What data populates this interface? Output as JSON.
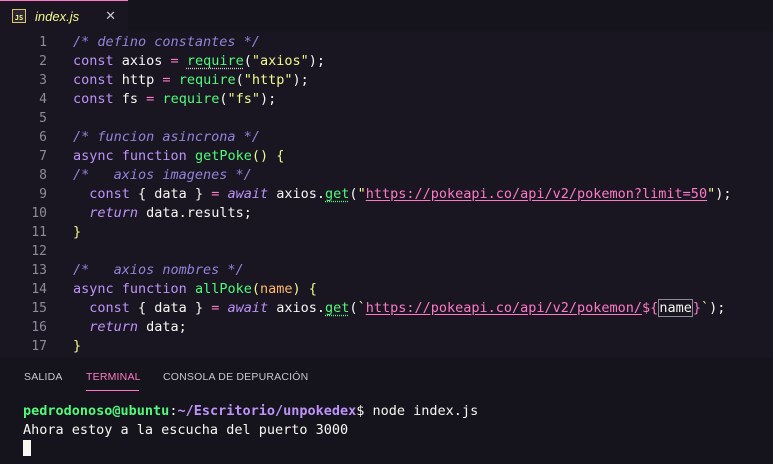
{
  "tab": {
    "icon": "JS",
    "filename": "index.js",
    "close": "✕"
  },
  "editor": {
    "lines": [
      {
        "n": "1",
        "tokens": [
          {
            "t": "/* defino constantes */",
            "c": "comment"
          }
        ]
      },
      {
        "n": "2",
        "tokens": [
          {
            "t": "const ",
            "c": "kw"
          },
          {
            "t": "axios",
            "c": "var"
          },
          {
            "t": " = ",
            "c": "op"
          },
          {
            "t": "require",
            "c": "req"
          },
          {
            "t": "(",
            "c": "var"
          },
          {
            "t": "\"axios\"",
            "c": "str"
          },
          {
            "t": ");",
            "c": "var"
          }
        ]
      },
      {
        "n": "3",
        "tokens": [
          {
            "t": "const ",
            "c": "kw"
          },
          {
            "t": "http",
            "c": "var"
          },
          {
            "t": " = ",
            "c": "op"
          },
          {
            "t": "require",
            "c": "fn"
          },
          {
            "t": "(",
            "c": "var"
          },
          {
            "t": "\"http\"",
            "c": "str"
          },
          {
            "t": ");",
            "c": "var"
          }
        ]
      },
      {
        "n": "4",
        "tokens": [
          {
            "t": "const ",
            "c": "kw"
          },
          {
            "t": "fs",
            "c": "var"
          },
          {
            "t": " = ",
            "c": "op"
          },
          {
            "t": "require",
            "c": "fn"
          },
          {
            "t": "(",
            "c": "var"
          },
          {
            "t": "\"fs\"",
            "c": "str"
          },
          {
            "t": ");",
            "c": "var"
          }
        ]
      },
      {
        "n": "5",
        "tokens": []
      },
      {
        "n": "6",
        "tokens": [
          {
            "t": "/* funcion asincrona */",
            "c": "comment"
          }
        ]
      },
      {
        "n": "7",
        "tokens": [
          {
            "t": "async ",
            "c": "kw"
          },
          {
            "t": "function ",
            "c": "kw"
          },
          {
            "t": "getPoke",
            "c": "fn"
          },
          {
            "t": "() {",
            "c": "brk"
          }
        ]
      },
      {
        "n": "8",
        "tokens": [
          {
            "t": "/*   axios imagenes */",
            "c": "comment"
          }
        ]
      },
      {
        "n": "9",
        "tokens": [
          {
            "t": "  const ",
            "c": "kw"
          },
          {
            "t": "{ ",
            "c": "var"
          },
          {
            "t": "data",
            "c": "var"
          },
          {
            "t": " } ",
            "c": "var"
          },
          {
            "t": "= ",
            "c": "op"
          },
          {
            "t": "await ",
            "c": "kwi"
          },
          {
            "t": "axios",
            "c": "var"
          },
          {
            "t": ".",
            "c": "var"
          },
          {
            "t": "get",
            "c": "fnu"
          },
          {
            "t": "(",
            "c": "var"
          },
          {
            "t": "\"",
            "c": "str"
          },
          {
            "t": "https://pokeapi.co/api/v2/pokemon?limit=50",
            "c": "url"
          },
          {
            "t": "\"",
            "c": "str"
          },
          {
            "t": ");",
            "c": "var"
          }
        ]
      },
      {
        "n": "10",
        "tokens": [
          {
            "t": "  return ",
            "c": "kwi"
          },
          {
            "t": "data",
            "c": "var"
          },
          {
            "t": ".",
            "c": "var"
          },
          {
            "t": "results",
            "c": "prop"
          },
          {
            "t": ";",
            "c": "var"
          }
        ]
      },
      {
        "n": "11",
        "tokens": [
          {
            "t": "}",
            "c": "brk"
          }
        ]
      },
      {
        "n": "12",
        "tokens": []
      },
      {
        "n": "13",
        "tokens": [
          {
            "t": "/*   axios nombres */",
            "c": "comment"
          }
        ]
      },
      {
        "n": "14",
        "tokens": [
          {
            "t": "async ",
            "c": "kw"
          },
          {
            "t": "function ",
            "c": "kw"
          },
          {
            "t": "allPoke",
            "c": "fn"
          },
          {
            "t": "(",
            "c": "brk"
          },
          {
            "t": "name",
            "c": "param"
          },
          {
            "t": ") {",
            "c": "brk"
          }
        ]
      },
      {
        "n": "15",
        "tokens": [
          {
            "t": "  const ",
            "c": "kw"
          },
          {
            "t": "{ ",
            "c": "var"
          },
          {
            "t": "data",
            "c": "var"
          },
          {
            "t": " } ",
            "c": "var"
          },
          {
            "t": "= ",
            "c": "op"
          },
          {
            "t": "await ",
            "c": "kwi"
          },
          {
            "t": "axios",
            "c": "var"
          },
          {
            "t": ".",
            "c": "var"
          },
          {
            "t": "get",
            "c": "fnu"
          },
          {
            "t": "(",
            "c": "var"
          },
          {
            "t": "`",
            "c": "str"
          },
          {
            "t": "https://pokeapi.co/api/v2/pokemon/",
            "c": "url"
          },
          {
            "t": "${",
            "c": "tpl"
          },
          {
            "t": "name",
            "c": "tplbox"
          },
          {
            "t": "}",
            "c": "tpl"
          },
          {
            "t": "`",
            "c": "str"
          },
          {
            "t": ");",
            "c": "var"
          }
        ]
      },
      {
        "n": "16",
        "tokens": [
          {
            "t": "  return ",
            "c": "kwi"
          },
          {
            "t": "data",
            "c": "var"
          },
          {
            "t": ";",
            "c": "var"
          }
        ]
      },
      {
        "n": "17",
        "tokens": [
          {
            "t": "}",
            "c": "brk"
          }
        ]
      }
    ]
  },
  "panel": {
    "tabs": [
      {
        "label": "SALIDA",
        "active": false
      },
      {
        "label": "TERMINAL",
        "active": true
      },
      {
        "label": "CONSOLA DE DEPURACIÓN",
        "active": false
      }
    ]
  },
  "terminal": {
    "prompt_user": "pedrodonoso@ubuntu",
    "prompt_sep": ":",
    "prompt_path": "~/Escritorio/unpokedex",
    "prompt_end": "$ ",
    "command": "node index.js",
    "output": "Ahora estoy a la escucha del puerto 3000"
  },
  "colors": {
    "background": "#191622",
    "accent": "#ff79c6",
    "comment": "#9483d9",
    "keyword": "#bd93f9",
    "function": "#50fa7b",
    "string": "#f1fa8c"
  }
}
